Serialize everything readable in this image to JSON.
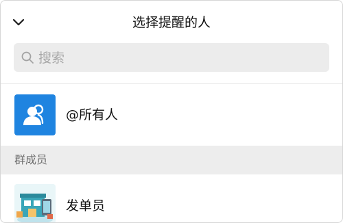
{
  "header": {
    "title": "选择提醒的人",
    "back_icon": "chevron-down-icon"
  },
  "search": {
    "placeholder": "搜索",
    "value": "",
    "icon": "search-icon"
  },
  "everyone": {
    "label": "@所有人",
    "icon": "group-people-icon",
    "accent_color": "#1f84e0"
  },
  "section": {
    "label": "群成员"
  },
  "members": [
    {
      "name": "发单员",
      "avatar": "shop-illustration-avatar"
    }
  ]
}
